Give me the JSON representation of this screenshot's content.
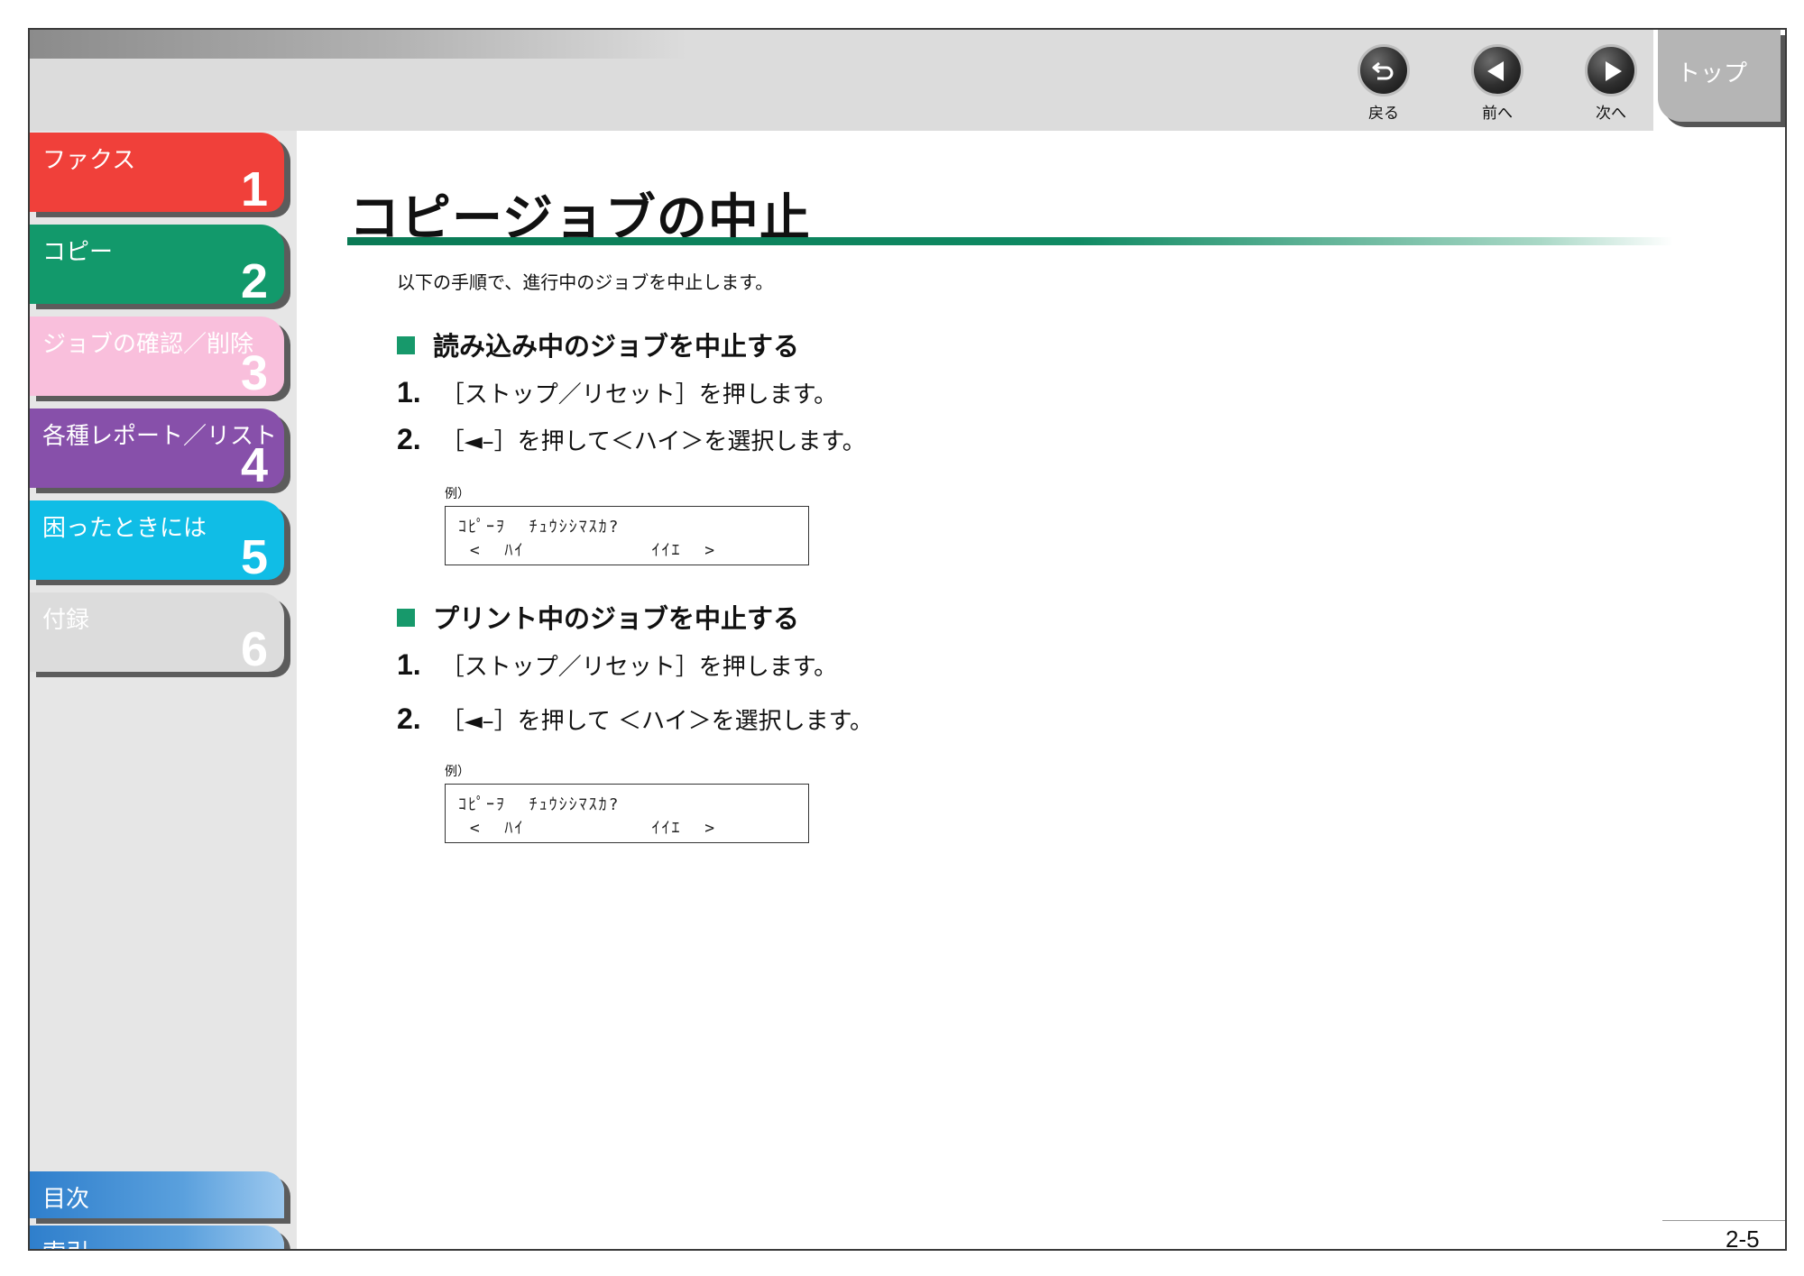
{
  "nav": {
    "back_label": "戻る",
    "prev_label": "前へ",
    "next_label": "次へ",
    "top_label": "トップ"
  },
  "sidebar": {
    "chapters": [
      {
        "title": "ファクス",
        "number": "1",
        "color": "#f0403a"
      },
      {
        "title": "コピー",
        "number": "2",
        "color": "#12996b"
      },
      {
        "title": "ジョブの確認／削除",
        "number": "3",
        "color": "#f9bfdc"
      },
      {
        "title": "各種レポート／リスト",
        "number": "4",
        "color": "#8750aa"
      },
      {
        "title": "困ったときには",
        "number": "5",
        "color": "#10bde6"
      },
      {
        "title": "付録",
        "number": "6",
        "color": "#dcdcdc"
      }
    ],
    "contents_label": "目次",
    "index_label": "索引"
  },
  "main": {
    "title": "コピージョブの中止",
    "intro": "以下の手順で、進行中のジョブを中止します。",
    "sections": [
      {
        "heading": "読み込み中のジョブを中止する",
        "steps": [
          {
            "num": "1.",
            "text": "［ストップ／リセット］を押します。"
          },
          {
            "num": "2.",
            "text": "［◄–］を押して＜ハイ＞を選択します。"
          }
        ],
        "example_label": "例）",
        "lcd_line1": "ｺﾋﾟｰｦ  ﾁｭｳｼｼﾏｽｶ?",
        "lcd_line2": " <  ﾊｲ           ｲｲｴ  >"
      },
      {
        "heading": "プリント中のジョブを中止する",
        "steps": [
          {
            "num": "1.",
            "text": "［ストップ／リセット］を押します。"
          },
          {
            "num": "2.",
            "text": "［◄–］を押して ＜ハイ＞を選択します。"
          }
        ],
        "example_label": "例）",
        "lcd_line1": "ｺﾋﾟｰｦ  ﾁｭｳｼｼﾏｽｶ?",
        "lcd_line2": " <  ﾊｲ           ｲｲｴ  >"
      }
    ]
  },
  "footer": {
    "page_number": "2-5"
  }
}
